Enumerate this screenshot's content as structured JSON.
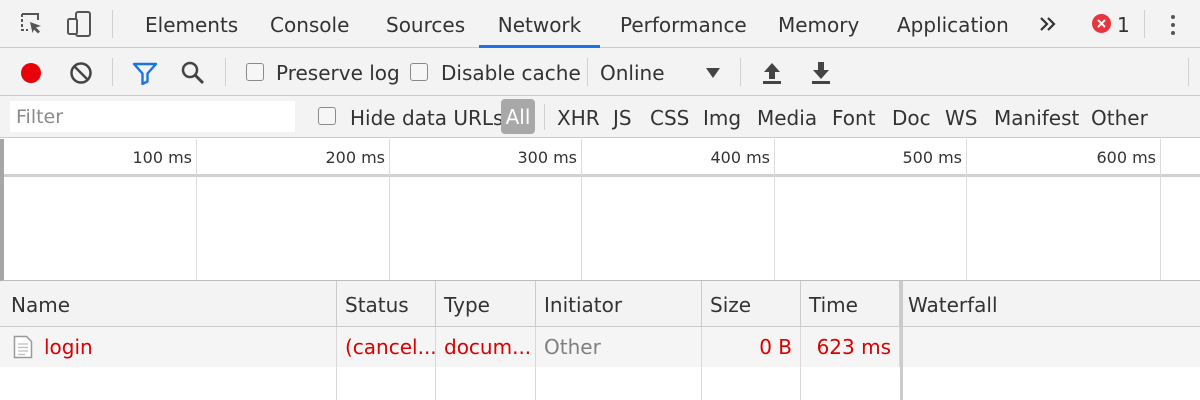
{
  "tabs": [
    "Elements",
    "Console",
    "Sources",
    "Network",
    "Performance",
    "Memory",
    "Application"
  ],
  "active_tab": "Network",
  "error_count": "1",
  "toolbar": {
    "preserve_log_label": "Preserve log",
    "disable_cache_label": "Disable cache",
    "throttling_value": "Online",
    "record_color": "#e8000a",
    "filter_icon_color": "#1a73e8"
  },
  "filterbar": {
    "filter_placeholder": "Filter",
    "hide_data_urls_label": "Hide data URLs",
    "types": [
      "All",
      "XHR",
      "JS",
      "CSS",
      "Img",
      "Media",
      "Font",
      "Doc",
      "WS",
      "Manifest",
      "Other"
    ],
    "active_type": "All"
  },
  "overview": {
    "tick_labels": [
      "100 ms",
      "200 ms",
      "300 ms",
      "400 ms",
      "500 ms",
      "600 ms"
    ]
  },
  "table": {
    "columns": [
      "Name",
      "Status",
      "Type",
      "Initiator",
      "Size",
      "Time",
      "Waterfall"
    ],
    "rows": [
      {
        "name": "login",
        "status": "(cancel...",
        "type": "docum...",
        "initiator": "Other",
        "size": "0 B",
        "time": "623 ms"
      }
    ]
  },
  "colors": {
    "error_text": "#d80000",
    "active_tab_underline": "#1a73e8",
    "error_badge": "#e8343c"
  },
  "icons": [
    "inspect-element-icon",
    "device-toolbar-icon",
    "more-tabs-icon",
    "error-icon",
    "kebab-menu-icon",
    "record-icon",
    "clear-icon",
    "filter-icon",
    "search-icon",
    "dropdown-arrow-icon",
    "import-har-icon",
    "export-har-icon",
    "document-icon"
  ]
}
